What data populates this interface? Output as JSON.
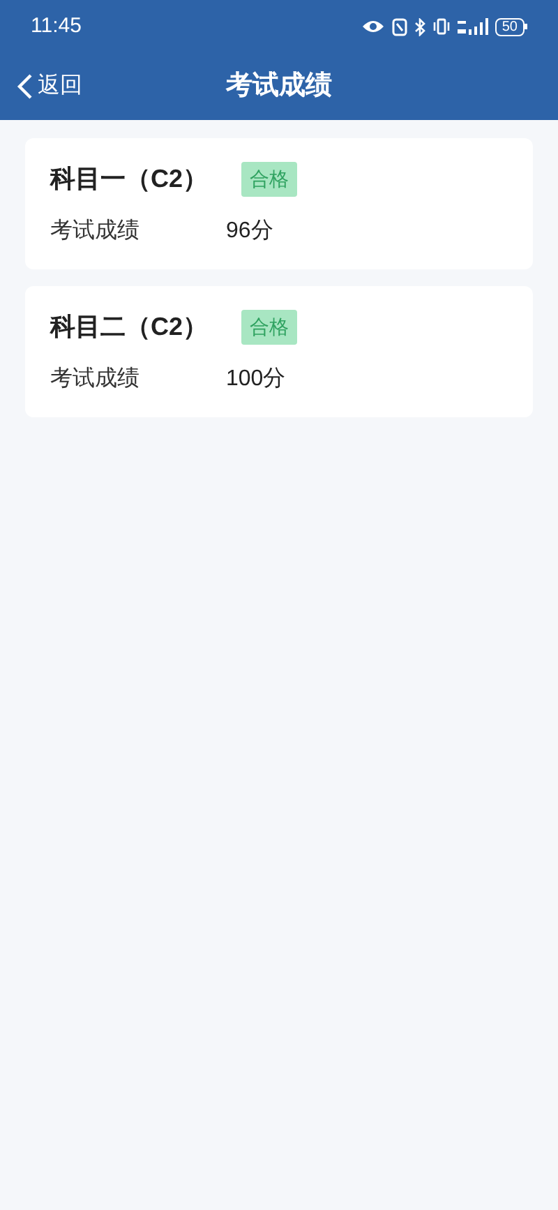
{
  "status_bar": {
    "time": "11:45",
    "battery": "50"
  },
  "header": {
    "back_label": "返回",
    "title": "考试成绩"
  },
  "results": [
    {
      "subject": "科目一（C2）",
      "badge": "合格",
      "label": "考试成绩",
      "score": "96分"
    },
    {
      "subject": "科目二（C2）",
      "badge": "合格",
      "label": "考试成绩",
      "score": "100分"
    }
  ]
}
